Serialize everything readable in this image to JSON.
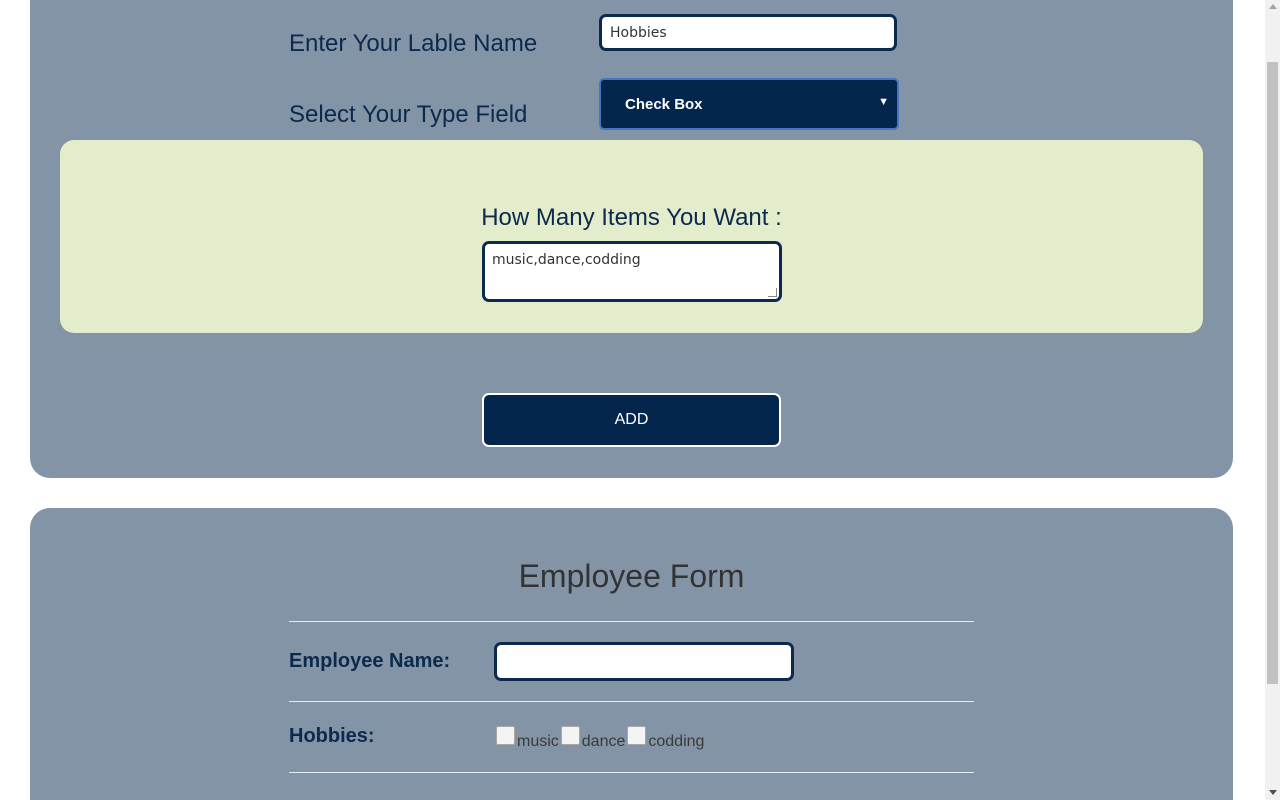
{
  "builder": {
    "label_name_text": "Enter Your Lable Name",
    "label_name_value": "Hobbies",
    "type_field_text": "Select Your Type Field",
    "type_selected": "Check Box",
    "items_prompt": "How Many Items You Want :",
    "items_value": "music,dance,codding",
    "add_button": "ADD"
  },
  "employee_form": {
    "title": "Employee Form",
    "name_label": "Employee Name:",
    "name_value": "",
    "hobbies_label": "Hobbies:",
    "hobbies_options": [
      {
        "label": "music",
        "checked": false
      },
      {
        "label": "dance",
        "checked": false
      },
      {
        "label": "codding",
        "checked": false
      }
    ]
  },
  "icons": {
    "select_caret": "caret-down-icon",
    "textarea_resize": "resize-grip-icon"
  },
  "colors": {
    "panel": "#8294a6",
    "accent_dark": "#04264d",
    "items_box": "#e3edcc"
  }
}
